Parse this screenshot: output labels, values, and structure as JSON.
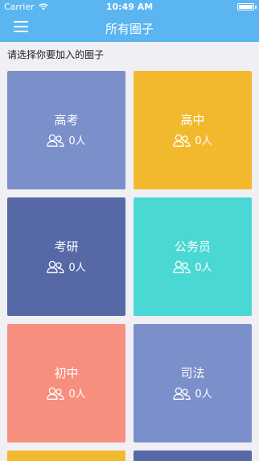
{
  "status_bar": {
    "carrier": "Carrier",
    "time": "10:49 AM"
  },
  "nav": {
    "title": "所有圈子",
    "menu_icon": "hamburger-menu-icon"
  },
  "subtitle": "请选择你要加入的圈子",
  "colors": {
    "header": "#5ab5f0",
    "background": "#efeff4"
  },
  "circles": [
    {
      "name": "高考",
      "count": "0人",
      "color": "#7b8fcb"
    },
    {
      "name": "高中",
      "count": "0人",
      "color": "#f3b92e"
    },
    {
      "name": "考研",
      "count": "0人",
      "color": "#5669a6"
    },
    {
      "name": "公务员",
      "count": "0人",
      "color": "#4ad8d4"
    },
    {
      "name": "初中",
      "count": "0人",
      "color": "#f78f7e"
    },
    {
      "name": "司法",
      "count": "0人",
      "color": "#7b8fcb"
    },
    {
      "name": "",
      "count": "",
      "color": "#f3b92e"
    },
    {
      "name": "",
      "count": "",
      "color": "#5669a6"
    }
  ]
}
